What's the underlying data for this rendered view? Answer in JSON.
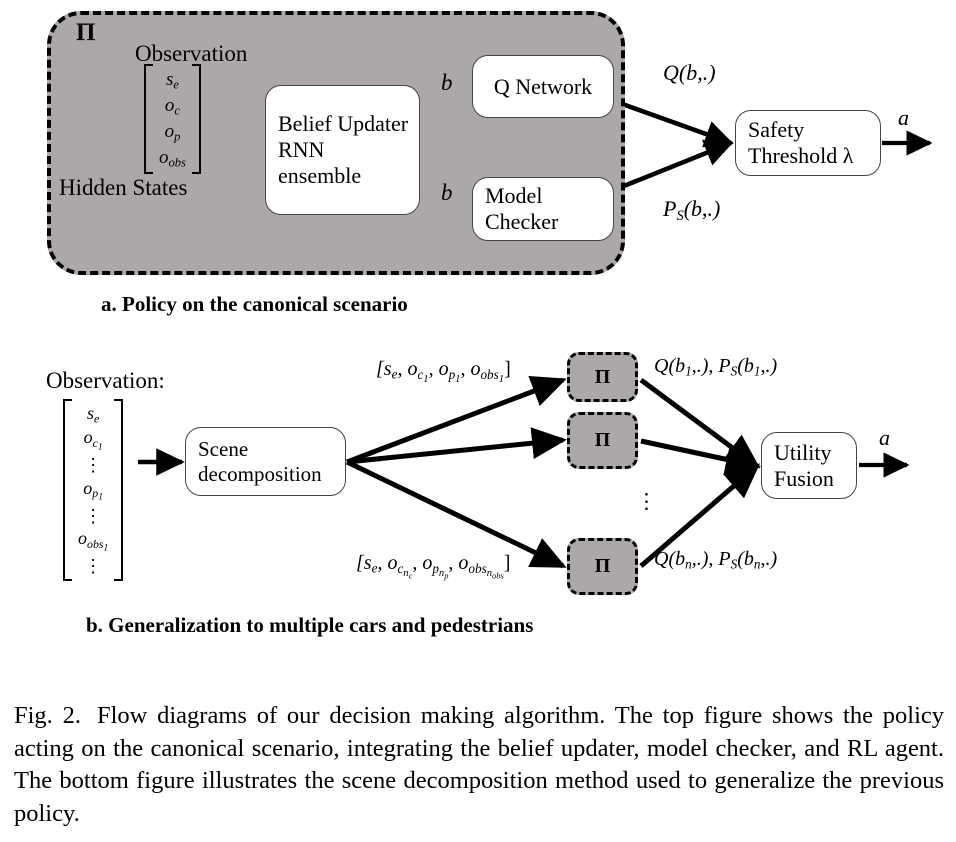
{
  "figure": {
    "panel_a": {
      "policy_symbol": "Π",
      "observation_label": "Observation",
      "observation_vector": [
        "s_e",
        "o_c",
        "o_p",
        "o_obs"
      ],
      "hidden_states_label": "Hidden States",
      "belief_updater_box": "Belief Updater RNN ensemble",
      "belief_updater_lines": [
        "Belief Updater",
        "RNN",
        "ensemble"
      ],
      "q_network_box": "Q Network",
      "model_checker_lines": [
        "Model",
        "Checker"
      ],
      "safety_threshold_lines": [
        "Safety",
        "Threshold λ"
      ],
      "belief_edge_label_top": "b",
      "belief_edge_label_bottom": "b",
      "q_value_label": "Q(b,.)",
      "safety_prob_label": "P_S(b,.)",
      "action_label": "a",
      "subcaption": "a. Policy on the canonical scenario"
    },
    "panel_b": {
      "observation_label": "Observation:",
      "observation_vector": [
        "s_e",
        "o_c1",
        "⋮",
        "o_p1",
        "⋮",
        "o_obs1",
        "⋮"
      ],
      "scene_decomposition_lines": [
        "Scene",
        "decomposition"
      ],
      "decomposed_obs_first": "[s_e, o_c1, o_p1, o_obs1]",
      "decomposed_obs_last": "[s_e, o_cnc, o_pnp, o_obs_nobs]",
      "policy_symbol": "Π",
      "policy_instances": [
        "Π",
        "Π",
        "Π"
      ],
      "vertical_ellipsis": "⋮",
      "utility_first_label": "Q(b_1,.), P_S(b_1,.)",
      "utility_last_label": "Q(b_n,.), P_S(b_n,.)",
      "utility_fusion_lines": [
        "Utility",
        "Fusion"
      ],
      "action_label": "a",
      "subcaption": "b. Generalization to multiple cars and pedestrians"
    },
    "caption": {
      "label": "Fig. 2.",
      "text": "Flow diagrams of our decision making algorithm. The top figure shows the policy acting on the canonical scenario, integrating the belief updater, model checker, and RL agent. The bottom figure illustrates the scene decomposition method used to generalize the previous policy."
    },
    "colors": {
      "policy_fill": "#aba8a7",
      "box_fill": "#ffffff",
      "stroke": "#000000",
      "background": "#ffffff"
    }
  }
}
